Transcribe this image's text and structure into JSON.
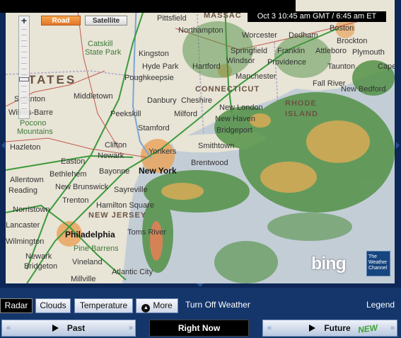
{
  "timestamp": "Oct 3  10:45 am GMT / 6:45 am ET",
  "map_type": {
    "road": "Road",
    "satellite": "Satellite",
    "active": "road"
  },
  "zoom": {
    "plus": "+"
  },
  "labels": {
    "states": [
      "TATES",
      "MASSAC",
      "CONNECTICUT",
      "RHODE",
      "ISLAND",
      "NEW JERSEY"
    ],
    "parks": [
      "Catskill",
      "State Park",
      "Pocono",
      "Mountains",
      "Pine Barrens"
    ],
    "major_cities": [
      "New York",
      "Philadelphia"
    ],
    "cities": [
      "Pittsfield",
      "Northampton",
      "Worcester",
      "Dedham",
      "Boston",
      "Brockton",
      "Springfield",
      "Franklin",
      "Attleboro",
      "Plymouth",
      "Kingston",
      "Windsor",
      "Providence",
      "Taunton",
      "Cape",
      "Hyde Park",
      "Hartford",
      "Manchester",
      "Poughkeepsie",
      "Fall River",
      "New Bedford",
      "Scranton",
      "Middletown",
      "Danbury",
      "Cheshire",
      "Wilkes-Barre",
      "Peekskill",
      "Milford",
      "New London",
      "New Haven",
      "Stamford",
      "Bridgeport",
      "Hazleton",
      "Clifton",
      "Newark",
      "Yonkers",
      "Smithtown",
      "Easton",
      "Brentwood",
      "Allentown",
      "Bethlehem",
      "Bayonne",
      "New Brunswick",
      "Reading",
      "Sayreville",
      "Trenton",
      "Norristown",
      "Hamilton Square",
      "Toms River",
      "Lancaster",
      "Wilmington",
      "Newark",
      "Vineland",
      "Bridgeton",
      "Atlantic City",
      "Millville"
    ]
  },
  "logos": {
    "bing": "bing",
    "twc": "The Weather Channel"
  },
  "layers": {
    "radar": "Radar",
    "clouds": "Clouds",
    "temperature": "Temperature",
    "more": "More",
    "active": "radar"
  },
  "links": {
    "turn_off": "Turn Off Weather",
    "legend": "Legend"
  },
  "timeline": {
    "past": "Past",
    "now": "Right Now",
    "future": "Future",
    "badge": "NEW"
  },
  "icons": [
    "zoom-plus-icon",
    "zoom-slider-icon",
    "pan-left-icon",
    "pan-right-icon",
    "pan-down-icon",
    "more-triangle-icon",
    "play-icon",
    "chevrons-icon"
  ]
}
